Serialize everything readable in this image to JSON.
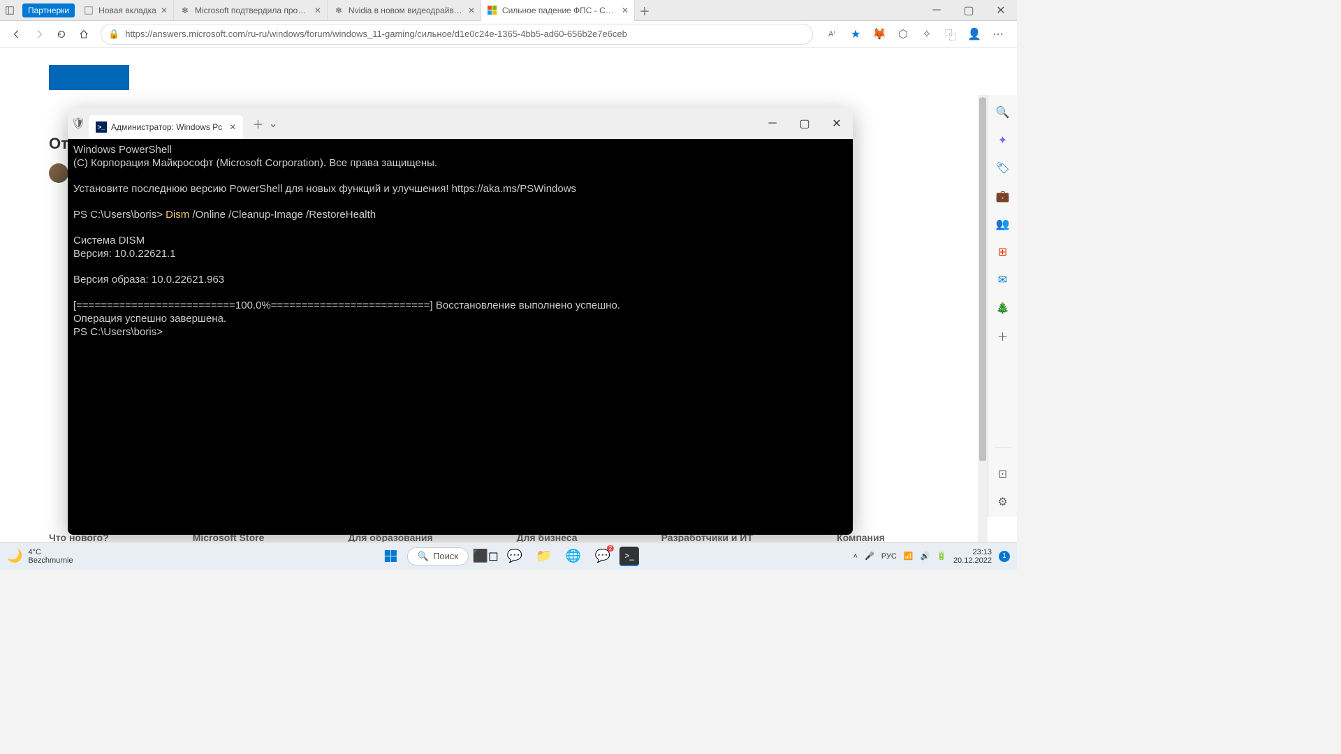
{
  "browser": {
    "partner_badge": "Партнерки",
    "tabs": [
      {
        "favicon": "page",
        "title": "Новая вкладка"
      },
      {
        "favicon": "gear-blue",
        "title": "Microsoft подтвердила пробле"
      },
      {
        "favicon": "gear-blue",
        "title": "Nvidia в новом видеодрайвере"
      },
      {
        "favicon": "ms",
        "title": "Сильное падение ФПС - Сооб",
        "active": true
      }
    ],
    "url": "https://answers.microsoft.com/ru-ru/windows/forum/windows_11-gaming/сильное/d1e0c24e-1365-4bb5-ad60-656b2e7e6ceb"
  },
  "page": {
    "heading": "От",
    "footer_cols": [
      "Что нового?",
      "Microsoft Store",
      "Для образования",
      "Для бизнеса",
      "Разработчики и ИТ",
      "Компания"
    ]
  },
  "terminal": {
    "tab_title": "Администратор: Windows Pc",
    "lines": {
      "l1": "Windows PowerShell",
      "l2": "(C) Корпорация Майкрософт (Microsoft Corporation). Все права защищены.",
      "l3": "Установите последнюю версию PowerShell для новых функций и улучшения! https://aka.ms/PSWindows",
      "prompt1": "PS C:\\Users\\boris> ",
      "cmd": "Dism",
      "cmd_args": " /Online /Cleanup-Image /RestoreHealth",
      "l5": "Система DISM",
      "l6": "Версия: 10.0.22621.1",
      "l7": "Версия образа: 10.0.22621.963",
      "l8": "[==========================100.0%==========================] Восстановление выполнено успешно.",
      "l9": "Операция успешно завершена.",
      "prompt2": "PS C:\\Users\\boris> "
    }
  },
  "taskbar": {
    "weather_temp": "4°C",
    "weather_desc": "Bezchmurnie",
    "search": "Поиск",
    "tray_lang": "РУС",
    "time": "23:13",
    "date": "20.12.2022"
  }
}
